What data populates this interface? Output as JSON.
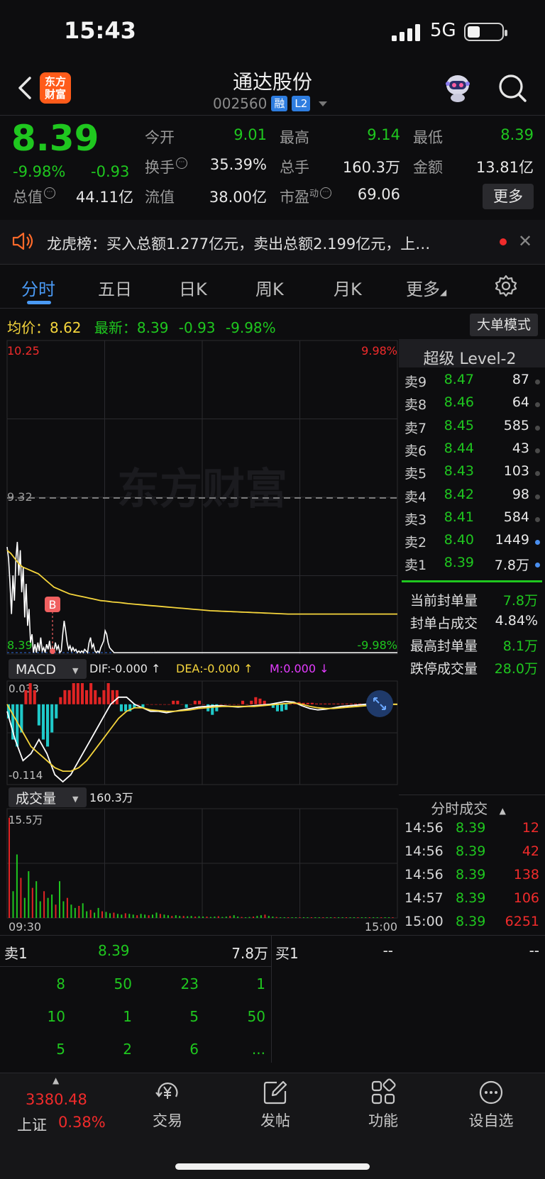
{
  "status_bar": {
    "time": "15:43",
    "network": "5G"
  },
  "header": {
    "logo_line1": "东方",
    "logo_line2": "财富",
    "title": "通达股份",
    "code": "002560",
    "tag_margin": "融",
    "tag_level": "L2"
  },
  "quote": {
    "price": "8.39",
    "pct": "-9.98%",
    "change": "-0.93",
    "fields": [
      {
        "label": "今开",
        "value": "9.01",
        "color": "green"
      },
      {
        "label": "最高",
        "value": "9.14",
        "color": "green"
      },
      {
        "label": "最低",
        "value": "8.39",
        "color": "green"
      },
      {
        "label": "换手",
        "value": "35.39%",
        "color": "white"
      },
      {
        "label": "总手",
        "value": "160.3万",
        "color": "white"
      },
      {
        "label": "金额",
        "value": "13.81亿",
        "color": "white"
      },
      {
        "label": "总值",
        "value": "44.11亿",
        "color": "white"
      },
      {
        "label": "流值",
        "value": "38.00亿",
        "color": "white"
      },
      {
        "label": "市盈",
        "value": "69.06",
        "color": "white"
      }
    ],
    "pe_superscript": "动",
    "more_label": "更多"
  },
  "news": {
    "text": "龙虎榜：买入总额1.277亿元，卖出总额2.199亿元，上…"
  },
  "tabs": [
    {
      "label": "分时",
      "active": true
    },
    {
      "label": "五日"
    },
    {
      "label": "日K"
    },
    {
      "label": "周K"
    },
    {
      "label": "月K"
    },
    {
      "label": "更多"
    }
  ],
  "avg_row": {
    "avg_label": "均价：",
    "avg_value": "8.62",
    "latest_label": "最新：",
    "latest_value": "8.39",
    "latest_change": "-0.93",
    "latest_pct": "-9.98%",
    "big_order_label": "大单模式"
  },
  "chart_data": [
    {
      "type": "line",
      "title": "",
      "watermark": "东方财富",
      "y_labels": {
        "top": "10.25",
        "mid": "9.32",
        "bottom": "8.39",
        "top_pct": "9.98%",
        "bottom_pct": "-9.98%"
      },
      "ylim": [
        8.39,
        10.25
      ],
      "ref_price": 9.32,
      "x_labels": {
        "start": "09:30",
        "end": "15:00"
      },
      "marker": "B",
      "series": [
        {
          "kind": "price",
          "color": "#ffffff",
          "values": [
            9.02,
            8.95,
            8.8,
            8.62,
            8.85,
            8.7,
            8.95,
            9.05,
            8.85,
            9.0,
            8.75,
            8.9,
            8.6,
            8.8,
            8.55,
            8.65,
            8.45,
            8.5,
            8.39,
            8.44,
            8.39,
            8.45,
            8.4,
            8.48,
            8.4,
            8.42,
            8.39,
            8.44,
            8.41,
            8.46,
            8.39,
            8.42,
            8.4,
            8.45,
            8.41,
            8.43,
            8.39,
            8.4,
            8.5,
            8.58,
            8.52,
            8.45,
            8.41,
            8.43,
            8.4,
            8.42,
            8.4,
            8.41,
            8.39,
            8.4,
            8.39,
            8.4,
            8.39,
            8.41,
            8.4,
            8.39,
            8.45,
            8.48,
            8.42,
            8.44,
            8.4,
            8.39,
            8.4,
            8.39,
            8.42,
            8.44,
            8.46,
            8.52,
            8.5,
            8.45,
            8.42,
            8.41,
            8.4,
            8.39,
            8.39,
            8.39,
            8.39,
            8.39,
            8.39,
            8.39,
            8.39,
            8.39,
            8.39,
            8.39,
            8.39,
            8.39,
            8.39,
            8.39,
            8.39,
            8.39,
            8.39,
            8.39,
            8.39,
            8.39,
            8.39,
            8.39,
            8.39,
            8.39,
            8.39,
            8.39,
            8.39
          ]
        },
        {
          "kind": "avg",
          "color": "#f5d53c",
          "values": [
            9.0,
            8.98,
            8.95,
            8.92,
            8.9,
            8.89,
            8.88,
            8.87,
            8.86,
            8.84,
            8.82,
            8.8,
            8.78,
            8.77,
            8.76,
            8.75,
            8.74,
            8.735,
            8.73,
            8.725,
            8.72,
            8.715,
            8.71,
            8.705,
            8.7,
            8.698,
            8.695,
            8.692,
            8.69,
            8.688,
            8.685,
            8.682,
            8.68,
            8.678,
            8.676,
            8.674,
            8.672,
            8.67,
            8.668,
            8.666,
            8.664,
            8.662,
            8.66,
            8.658,
            8.656,
            8.654,
            8.652,
            8.65,
            8.648,
            8.646,
            8.644,
            8.642,
            8.64,
            8.639,
            8.638,
            8.637,
            8.636,
            8.635,
            8.634,
            8.633,
            8.632,
            8.631,
            8.63,
            8.629,
            8.628,
            8.627,
            8.626,
            8.625,
            8.624,
            8.623,
            8.622,
            8.621,
            8.62,
            8.62,
            8.62,
            8.62,
            8.62,
            8.62,
            8.62,
            8.62,
            8.62,
            8.62,
            8.62,
            8.62,
            8.62,
            8.62,
            8.62,
            8.62,
            8.62,
            8.62,
            8.62,
            8.62,
            8.62,
            8.62,
            8.62,
            8.62,
            8.62,
            8.62,
            8.62,
            8.62,
            8.62
          ]
        }
      ]
    },
    {
      "type": "bar",
      "title": "MACD",
      "dif_label": "DIF:-0.000 ↑",
      "dea_label": "DEA:-0.000 ↑",
      "m_label": "M:0.000 ↓",
      "y_labels": {
        "top": "0.033",
        "bottom": "-0.114"
      },
      "ylim": [
        -0.114,
        0.033
      ],
      "histogram": [
        -0.02,
        -0.05,
        -0.06,
        -0.04,
        0.02,
        0.03,
        0.02,
        -0.03,
        -0.05,
        -0.06,
        -0.04,
        -0.02,
        0.01,
        0.02,
        0.02,
        0.03,
        0.03,
        0.03,
        0.02,
        0.03,
        0.02,
        0.01,
        0.02,
        0.03,
        0.02,
        0.02,
        -0.01,
        -0.01,
        -0.01,
        -0.005,
        0.0,
        -0.005,
        0.0,
        0.0,
        0.0,
        0.0,
        0.0,
        0.0,
        0.005,
        0.005,
        0.0,
        -0.005,
        0.0,
        0.005,
        0.005,
        0.0,
        -0.01,
        -0.015,
        -0.01,
        0.0,
        0.0,
        0.0,
        0.0,
        0.0,
        0.005,
        0.0,
        0.005,
        0.01,
        0.008,
        0.005,
        0.0,
        -0.005,
        -0.01,
        -0.01,
        -0.008,
        0.0,
        0.002,
        0.003,
        0.002,
        0.002,
        0.002,
        0.001,
        0.001,
        0.001,
        0.001,
        0.001,
        0.001,
        0.001,
        0.001,
        0.001,
        0.001,
        0.001,
        0.0,
        0.0,
        0.0,
        0.0,
        0.0,
        0.0,
        0.0,
        0.0
      ],
      "dif": [
        -0.01,
        -0.05,
        -0.08,
        -0.07,
        -0.05,
        -0.07,
        -0.1,
        -0.11,
        -0.1,
        -0.08,
        -0.06,
        -0.04,
        -0.02,
        0.0,
        0.01,
        0.01,
        0.0,
        -0.005,
        -0.01,
        -0.01,
        -0.012,
        -0.01,
        -0.008,
        -0.006,
        -0.004,
        -0.003,
        -0.002,
        -0.002,
        -0.003,
        -0.004,
        -0.003,
        -0.002,
        -0.001,
        0.0,
        0.002,
        0.004,
        0.003,
        -0.002,
        -0.006,
        -0.008,
        -0.007,
        -0.005,
        -0.003,
        -0.002,
        -0.001,
        0.0,
        0.0,
        0.0,
        0.0,
        0.0
      ],
      "dea": [
        0.0,
        -0.02,
        -0.04,
        -0.06,
        -0.07,
        -0.08,
        -0.09,
        -0.095,
        -0.095,
        -0.09,
        -0.08,
        -0.065,
        -0.05,
        -0.035,
        -0.02,
        -0.01,
        -0.005,
        -0.005,
        -0.008,
        -0.009,
        -0.01,
        -0.01,
        -0.009,
        -0.008,
        -0.006,
        -0.005,
        -0.004,
        -0.003,
        -0.003,
        -0.003,
        -0.003,
        -0.003,
        -0.002,
        -0.001,
        0.0,
        0.001,
        0.002,
        0.0,
        -0.003,
        -0.005,
        -0.006,
        -0.006,
        -0.005,
        -0.004,
        -0.003,
        -0.002,
        -0.001,
        0.0,
        0.0,
        0.0
      ]
    },
    {
      "type": "bar",
      "title": "成交量",
      "total_label": "160.3万",
      "y_labels": {
        "top": "15.5万"
      },
      "ylim": [
        0,
        155000
      ],
      "values": [
        150000,
        40000,
        95000,
        60000,
        30000,
        70000,
        45000,
        55000,
        25000,
        40000,
        30000,
        35000,
        20000,
        55000,
        25000,
        30000,
        20000,
        15000,
        18000,
        22000,
        10000,
        12000,
        8000,
        15000,
        10000,
        9000,
        7000,
        8000,
        6000,
        5000,
        7000,
        6000,
        5000,
        4000,
        6000,
        5000,
        4000,
        5000,
        8000,
        6000,
        5000,
        4000,
        3000,
        4000,
        3000,
        3000,
        2500,
        3000,
        2000,
        2500,
        2000,
        2000,
        1500,
        2000,
        2500,
        1500,
        2000,
        3000,
        4000,
        2000,
        1500,
        1000,
        1500,
        2000,
        3000,
        4000,
        5000,
        3000,
        2000,
        1500,
        1000,
        1000,
        800,
        800,
        900,
        700,
        800,
        600,
        700,
        500,
        600,
        500,
        500,
        400,
        500,
        400,
        600,
        500,
        400,
        500,
        300,
        400,
        500,
        400,
        300,
        400,
        500,
        400,
        600,
        800
      ]
    }
  ],
  "order_book": {
    "title": "超级 Level-2",
    "asks": [
      {
        "label": "卖9",
        "price": "8.47",
        "vol": "87"
      },
      {
        "label": "卖8",
        "price": "8.46",
        "vol": "64"
      },
      {
        "label": "卖7",
        "price": "8.45",
        "vol": "585"
      },
      {
        "label": "卖6",
        "price": "8.44",
        "vol": "43"
      },
      {
        "label": "卖5",
        "price": "8.43",
        "vol": "103"
      },
      {
        "label": "卖4",
        "price": "8.42",
        "vol": "98"
      },
      {
        "label": "卖3",
        "price": "8.41",
        "vol": "584"
      },
      {
        "label": "卖2",
        "price": "8.40",
        "vol": "1449"
      },
      {
        "label": "卖1",
        "price": "8.39",
        "vol": "7.8万"
      }
    ],
    "stats": [
      {
        "label": "当前封单量",
        "value": "7.8万"
      },
      {
        "label": "封单占成交",
        "value": "4.84%"
      },
      {
        "label": "最高封单量",
        "value": "8.1万"
      },
      {
        "label": "跌停成交量",
        "value": "28.0万"
      }
    ]
  },
  "trades": {
    "title": "分时成交",
    "rows": [
      {
        "time": "14:56",
        "price": "8.39",
        "vol": "12"
      },
      {
        "time": "14:56",
        "price": "8.39",
        "vol": "42"
      },
      {
        "time": "14:56",
        "price": "8.39",
        "vol": "138"
      },
      {
        "time": "14:57",
        "price": "8.39",
        "vol": "106"
      },
      {
        "time": "15:00",
        "price": "8.39",
        "vol": "6251"
      }
    ]
  },
  "level_bottom": {
    "sell1_label": "卖1",
    "sell1_price": "8.39",
    "sell1_vol": "7.8万",
    "buy1_label": "买1",
    "buy1_price": "--",
    "buy1_vol": "--",
    "queue": [
      [
        "8",
        "50",
        "23",
        "1"
      ],
      [
        "10",
        "1",
        "5",
        "50"
      ],
      [
        "5",
        "2",
        "6",
        "..."
      ]
    ]
  },
  "bottom_nav": {
    "index_value": "3380.48",
    "index_name": "上证",
    "index_pct": "0.38%",
    "items": [
      {
        "label": "交易"
      },
      {
        "label": "发帖"
      },
      {
        "label": "功能"
      },
      {
        "label": "设自选"
      }
    ]
  }
}
